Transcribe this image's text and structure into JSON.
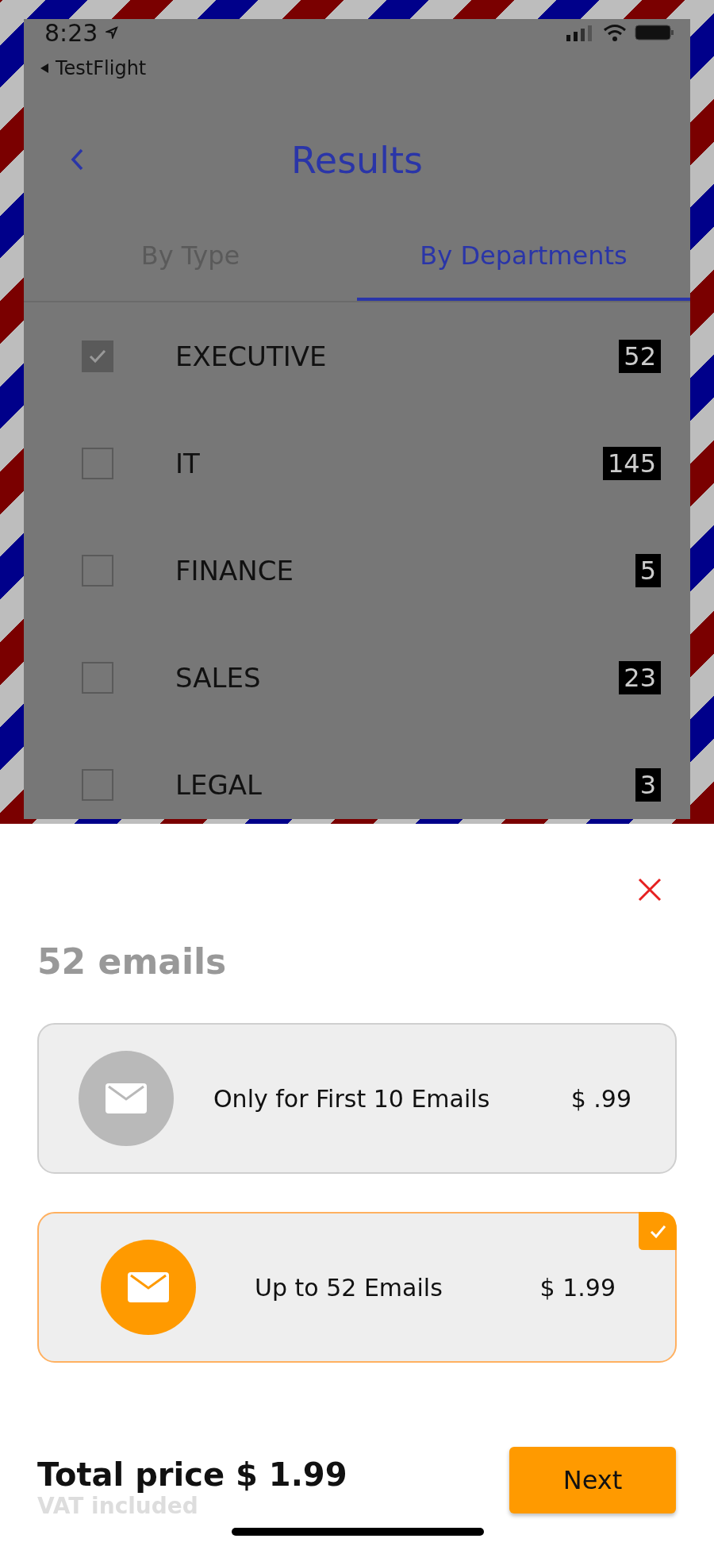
{
  "status_bar": {
    "time": "8:23",
    "back_app": "TestFlight"
  },
  "header": {
    "title": "Results"
  },
  "tabs": [
    {
      "label": "By Type",
      "selected": false
    },
    {
      "label": "By Departments",
      "selected": true
    }
  ],
  "departments": [
    {
      "name": "EXECUTIVE",
      "count": "52",
      "checked": true
    },
    {
      "name": "IT",
      "count": "145",
      "checked": false
    },
    {
      "name": "FINANCE",
      "count": "5",
      "checked": false
    },
    {
      "name": "SALES",
      "count": "23",
      "checked": false
    },
    {
      "name": "LEGAL",
      "count": "3",
      "checked": false
    }
  ],
  "sheet": {
    "title": "52 emails",
    "options": [
      {
        "label": "Only for First 10 Emails",
        "price": "$ .99",
        "selected": false
      },
      {
        "label": "Up to 52 Emails",
        "price": "$ 1.99",
        "selected": true
      }
    ],
    "total": "Total price $ 1.99",
    "vat": "VAT included",
    "next_button": "Next"
  }
}
